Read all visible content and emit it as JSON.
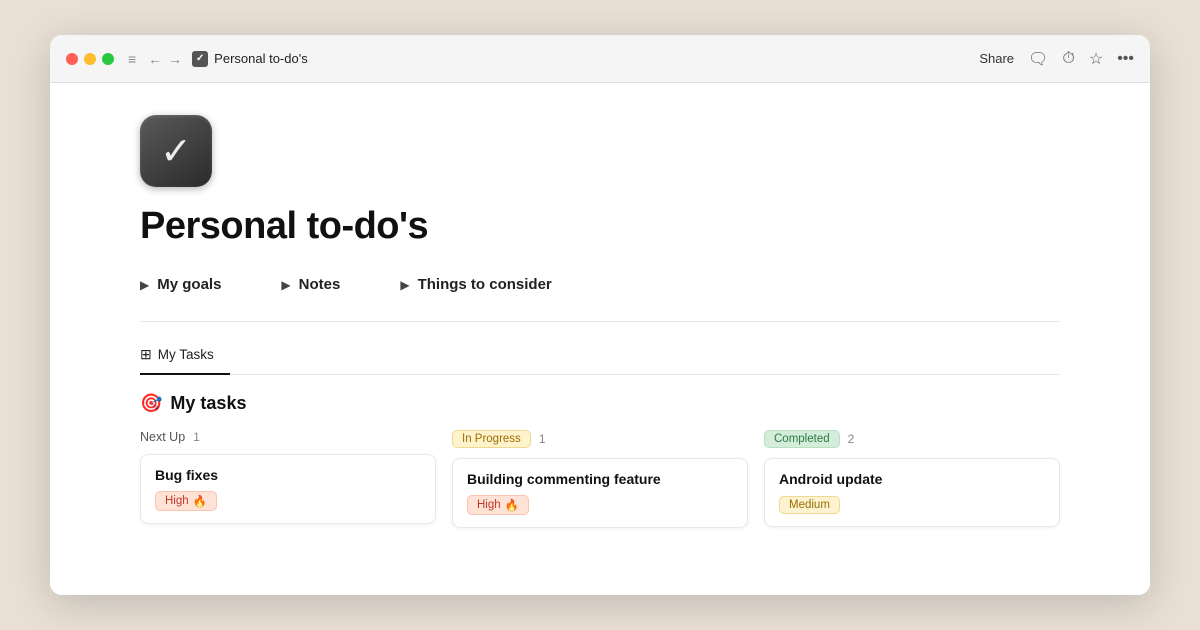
{
  "window": {
    "title": "Personal to-do's",
    "favicon": "✓"
  },
  "titlebar": {
    "share_label": "Share",
    "nav_back": "←",
    "nav_forward": "→",
    "menu_icon": "≡",
    "comment_icon": "💬",
    "history_icon": "🕐",
    "star_icon": "☆",
    "more_icon": "···"
  },
  "page": {
    "title": "Personal to-do's",
    "icon_symbol": "✓"
  },
  "sections": [
    {
      "label": "My goals",
      "arrow": "▶"
    },
    {
      "label": "Notes",
      "arrow": "▶"
    },
    {
      "label": "Things to consider",
      "arrow": "▶"
    }
  ],
  "tab_nav": {
    "icon": "⊞",
    "label": "My Tasks"
  },
  "tasks_section": {
    "emoji": "🎯",
    "title": "My tasks"
  },
  "columns": [
    {
      "id": "next-up",
      "label": "Next Up",
      "count": "1",
      "badge_text": null,
      "cards": [
        {
          "title": "Bug fixes",
          "priority_label": "High",
          "priority_emoji": "🔥",
          "priority_type": "high"
        }
      ]
    },
    {
      "id": "in-progress",
      "label": "In Progress",
      "count": "1",
      "badge_text": "In Progress",
      "badge_type": "inprogress",
      "cards": [
        {
          "title": "Building commenting feature",
          "priority_label": "High",
          "priority_emoji": "🔥",
          "priority_type": "high"
        }
      ]
    },
    {
      "id": "completed",
      "label": "Completed",
      "count": "2",
      "badge_text": "Completed",
      "badge_type": "completed",
      "cards": [
        {
          "title": "Android update",
          "priority_label": "Medium",
          "priority_emoji": "",
          "priority_type": "medium"
        }
      ]
    }
  ]
}
